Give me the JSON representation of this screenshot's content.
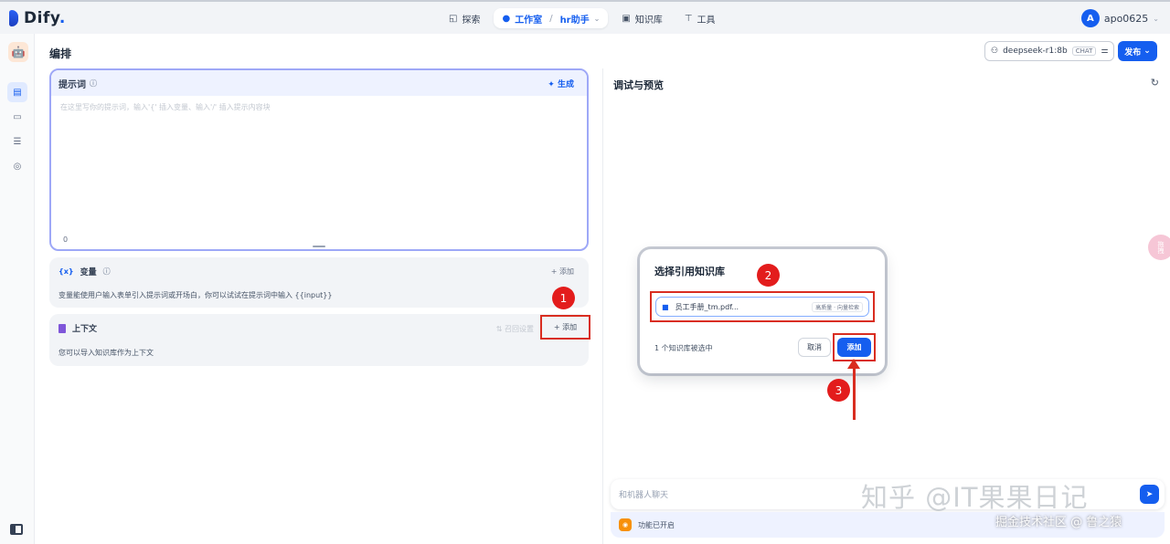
{
  "brand": {
    "name": "Dify",
    "dot": "."
  },
  "nav": {
    "explore": "探索",
    "studio": "工作室",
    "app_name": "hr助手",
    "knowledge": "知识库",
    "tools": "工具"
  },
  "user": {
    "initial": "A",
    "name": "apo0625"
  },
  "editor": {
    "title": "编排",
    "model": {
      "name": "deepseek-r1:8b",
      "mode": "CHAT"
    },
    "publish": "发布"
  },
  "prompt": {
    "title": "提示词",
    "generate": "生成",
    "placeholder": "在这里写你的提示词，输入'{' 插入变量、输入'/' 插入提示内容块",
    "count": "0"
  },
  "variables": {
    "title": "变量",
    "add": "+ 添加",
    "description": "变量能使用户输入表单引入提示词或开场白，你可以试试在提示词中输入 {{input}}"
  },
  "context": {
    "title": "上下文",
    "recall": "召回设置",
    "add": "+ 添加",
    "description": "您可以导入知识库作为上下文"
  },
  "debug": {
    "title": "调试与预览",
    "chat_placeholder": "和机器人聊天",
    "feature_text": "功能已开启"
  },
  "modal": {
    "title": "选择引用知识库",
    "kb_name": "员工手册_tm.pdf...",
    "kb_tag": "高质量 · 向量检索",
    "selected_text": "1 个知识库被选中",
    "cancel": "取消",
    "add": "添加"
  },
  "annotations": {
    "step1": "1",
    "step2": "2",
    "step3": "3"
  },
  "side_tab": "拖拽",
  "watermark": {
    "main": "知乎 @IT果果日记",
    "sub": "掘金技术社区 @ 鲁之猿"
  },
  "colors": {
    "primary": "#155eef",
    "annotation_red": "#d92d20"
  }
}
